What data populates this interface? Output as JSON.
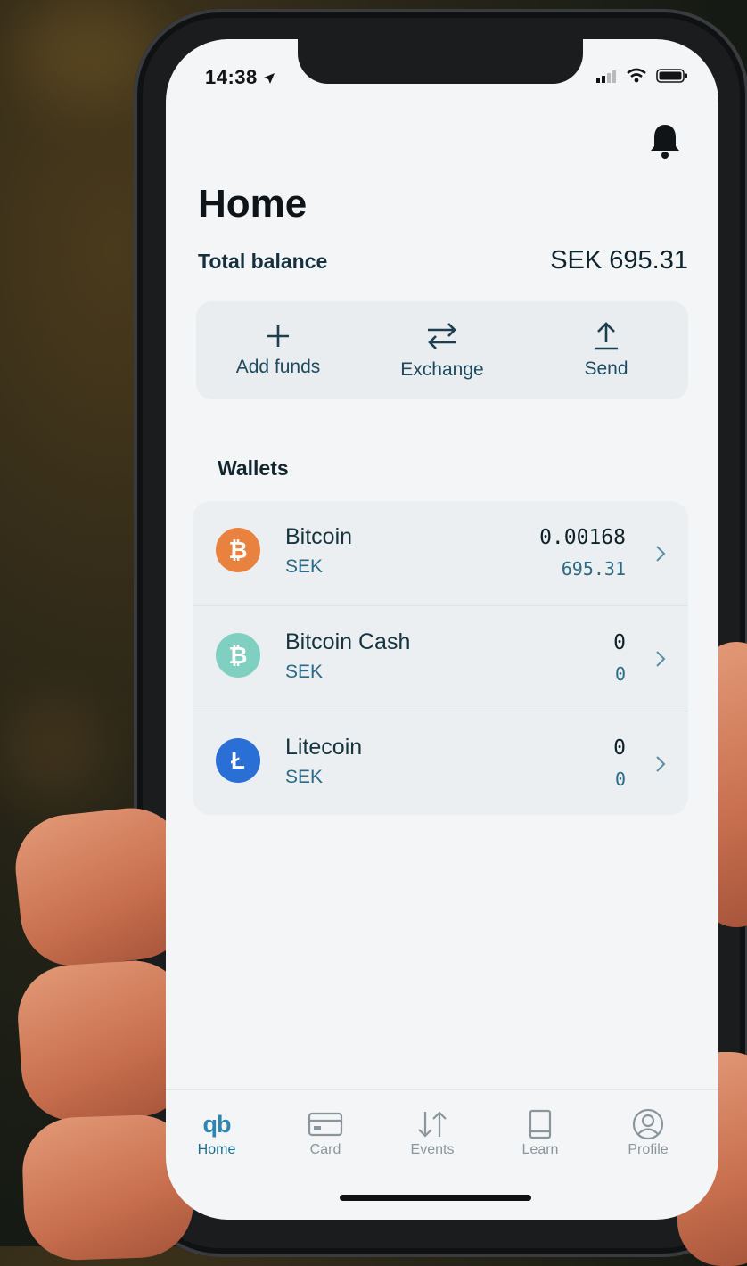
{
  "status_bar": {
    "time": "14:38"
  },
  "page": {
    "title": "Home"
  },
  "balance": {
    "label": "Total balance",
    "value": "SEK 695.31"
  },
  "actions": [
    {
      "label": "Add funds",
      "icon": "plus-icon"
    },
    {
      "label": "Exchange",
      "icon": "exchange-arrows-icon"
    },
    {
      "label": "Send",
      "icon": "upload-arrow-icon"
    }
  ],
  "wallets": {
    "heading": "Wallets",
    "items": [
      {
        "name": "Bitcoin",
        "currency": "SEK",
        "amount": "0.00168",
        "fiat": "695.31",
        "symbol": "₿",
        "color": "#e8823e"
      },
      {
        "name": "Bitcoin Cash",
        "currency": "SEK",
        "amount": "0",
        "fiat": "0",
        "symbol": "₿",
        "color": "#7fd0c0"
      },
      {
        "name": "Litecoin",
        "currency": "SEK",
        "amount": "0",
        "fiat": "0",
        "symbol": "Ł",
        "color": "#2a6fd6"
      }
    ]
  },
  "tabbar": {
    "brand": "qb",
    "items": [
      {
        "label": "Home",
        "icon": "qb-logo-icon",
        "active": true
      },
      {
        "label": "Card",
        "icon": "card-icon"
      },
      {
        "label": "Events",
        "icon": "events-arrows-icon"
      },
      {
        "label": "Learn",
        "icon": "book-icon"
      },
      {
        "label": "Profile",
        "icon": "profile-icon"
      }
    ]
  },
  "colors": {
    "accent": "#1d6d92",
    "background": "#f3f5f6"
  }
}
